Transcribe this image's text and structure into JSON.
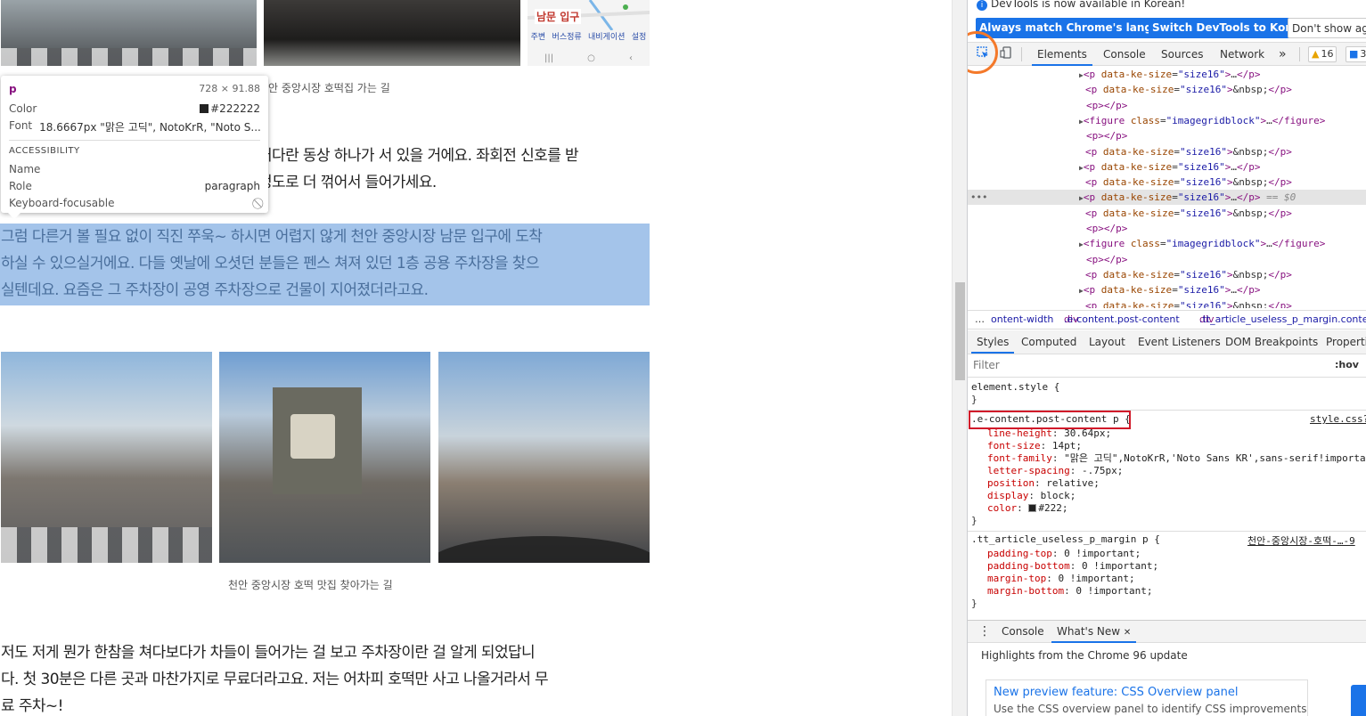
{
  "page": {
    "captions": {
      "top": "천안 중앙시장 호떡집 가는 길",
      "middle": "천안 중앙시장 호떡 맛집 찾아가는 길"
    },
    "map": {
      "label": "남문 입구",
      "nav_items": [
        "주변",
        "버스정류",
        "내비게이션",
        "설정"
      ],
      "bottom_items": [
        "|||",
        "○",
        "‹"
      ]
    },
    "para1": {
      "line1": "커다란 동상 하나가 서 있을 거에요. 좌회전 신호를 받",
      "line2": "정도로 더 꺾어서 들어가세요."
    },
    "para2": {
      "line1": "그럼 다른거 볼 필요 없이 직진 쭈욱~ 하시면 어렵지 않게 천안 중앙시장 남문 입구에 도착",
      "line2": "하실 수 있으실거에요. 다들 옛날에 오셧던 분들은 펜스 쳐져 있던 1층 공용 주차장을 찾으",
      "line3": "실텐데요. 요즘은 그 주차장이 공영 주차장으로 건물이 지어졌더라고요."
    },
    "para3": {
      "line1": "저도 저게 뭔가 한참을 쳐다보다가 차들이 들어가는 걸 보고 주차장이란 걸 알게 되었답니",
      "line2": "다. 첫 30분은 다른 곳과 마찬가지로 무료더라고요. 저는 어차피 호떡만 사고 나올거라서 무",
      "line3": "료 주차~!"
    }
  },
  "tooltip": {
    "tag": "p",
    "dimensions": "728 × 91.88",
    "color_label": "Color",
    "color_value": "#222222",
    "font_label": "Font",
    "font_value": "18.6667px \"맑은 고딕\", NotoKrR, \"Noto S...",
    "section": "ACCESSIBILITY",
    "name_label": "Name",
    "role_label": "Role",
    "role_value": "paragraph",
    "focus_label": "Keyboard-focusable"
  },
  "devtools": {
    "notice": "DevTools is now available in Korean!",
    "buttons": {
      "match": "Always match Chrome's language",
      "switch": "Switch DevTools to Korean",
      "dont": "Don't show aga"
    },
    "tabs": [
      "Elements",
      "Console",
      "Sources",
      "Network"
    ],
    "more": "»",
    "warnings": "16",
    "messages": "3",
    "dom_lines": [
      {
        "type": "p",
        "expand": true,
        "attr": "data-ke-size",
        "val": "\"size16\"",
        "content": "…",
        "sel": false
      },
      {
        "type": "p",
        "expand": false,
        "attr": "data-ke-size",
        "val": "\"size16\"",
        "content": "&nbsp;",
        "sel": false
      },
      {
        "type": "empty",
        "expand": false,
        "sel": false
      },
      {
        "type": "figure",
        "expand": true,
        "attr": "class",
        "val": "\"imagegridblock\"",
        "content": "…",
        "sel": false
      },
      {
        "type": "empty",
        "expand": false,
        "sel": false
      },
      {
        "type": "p",
        "expand": false,
        "attr": "data-ke-size",
        "val": "\"size16\"",
        "content": "&nbsp;",
        "sel": false
      },
      {
        "type": "p",
        "expand": true,
        "attr": "data-ke-size",
        "val": "\"size16\"",
        "content": "…",
        "sel": false
      },
      {
        "type": "p",
        "expand": false,
        "attr": "data-ke-size",
        "val": "\"size16\"",
        "content": "&nbsp;",
        "sel": false
      },
      {
        "type": "p",
        "expand": true,
        "attr": "data-ke-size",
        "val": "\"size16\"",
        "content": "…",
        "sel": true
      },
      {
        "type": "p",
        "expand": false,
        "attr": "data-ke-size",
        "val": "\"size16\"",
        "content": "&nbsp;",
        "sel": false
      },
      {
        "type": "empty",
        "expand": false,
        "sel": false
      },
      {
        "type": "figure",
        "expand": true,
        "attr": "class",
        "val": "\"imagegridblock\"",
        "content": "…",
        "sel": false
      },
      {
        "type": "empty",
        "expand": false,
        "sel": false
      },
      {
        "type": "p",
        "expand": false,
        "attr": "data-ke-size",
        "val": "\"size16\"",
        "content": "&nbsp;",
        "sel": false
      },
      {
        "type": "p",
        "expand": true,
        "attr": "data-ke-size",
        "val": "\"size16\"",
        "content": "…",
        "sel": false
      },
      {
        "type": "p",
        "expand": false,
        "attr": "data-ke-size",
        "val": "\"size16\"",
        "content": "&nbsp;",
        "sel": false
      }
    ],
    "selected_marker": "== $0",
    "breadcrumbs": {
      "ellipsis": "…",
      "c1": "ontent-width",
      "c2_el": "div",
      "c2_cls": ".e-content.post-content",
      "c3_el": "div",
      "c3_cls": ".tt_article_useless_p_margin.conte"
    },
    "style_tabs": [
      "Styles",
      "Computed",
      "Layout",
      "Event Listeners",
      "DOM Breakpoints",
      "Properties"
    ],
    "filter_placeholder": "Filter",
    "hov": ":hov",
    "element_style": "element.style {",
    "close_brace": "}",
    "rule1": {
      "selector": ".e-content.post-content p {",
      "source": "style.css?",
      "props": [
        {
          "name": "line-height",
          "value": "30.64px;"
        },
        {
          "name": "font-size",
          "value": "14pt;"
        },
        {
          "name": "font-family",
          "value": "\"맑은 고딕\",NotoKrR,'Noto Sans KR',sans-serif!important"
        },
        {
          "name": "letter-spacing",
          "value": "-.75px;"
        },
        {
          "name": "position",
          "value": "relative;"
        },
        {
          "name": "display",
          "value": "block;"
        },
        {
          "name": "color",
          "value": "#222;"
        }
      ]
    },
    "rule2": {
      "selector": ".tt_article_useless_p_margin p {",
      "source": "천안-중앙시장-호떡-…-9",
      "props": [
        {
          "name": "padding-top",
          "value": "0 !important;"
        },
        {
          "name": "padding-bottom",
          "value": "0 !important;"
        },
        {
          "name": "margin-top",
          "value": "0 !important;"
        },
        {
          "name": "margin-bottom",
          "value": "0 !important;"
        }
      ]
    },
    "drawer_tabs": [
      "Console",
      "What's New"
    ],
    "close_x": "✕",
    "drawer_menu": "⋮",
    "whats_new_heading": "Highlights from the Chrome 96 update",
    "card_title": "New preview feature: CSS Overview panel",
    "card_desc": "Use the CSS overview panel to identify CSS improvements"
  },
  "colors": {
    "accent": "#1a73e8",
    "highlight": "#a4c4ea",
    "ring": "#f4792a",
    "redbox": "#d11a2a"
  }
}
